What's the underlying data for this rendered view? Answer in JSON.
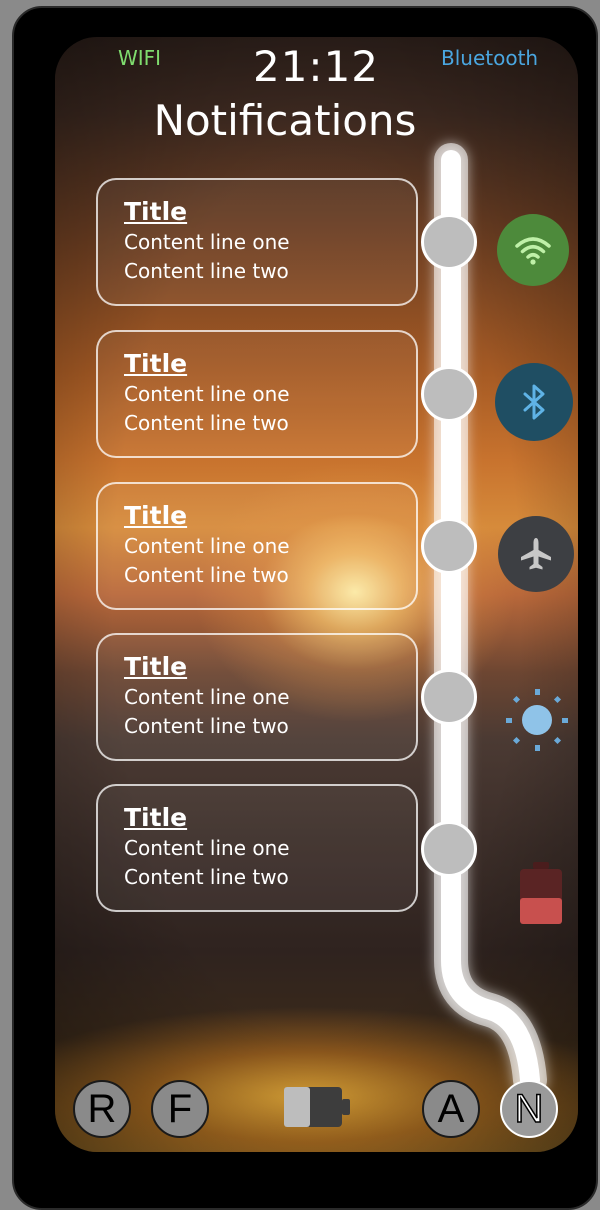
{
  "status_bar": {
    "wifi_label": "WIFI",
    "time": "21:12",
    "bluetooth_label": "Bluetooth"
  },
  "page_title": "Notifications",
  "notifications": [
    {
      "title": "Title",
      "line1": "Content line one",
      "line2": "Content line two"
    },
    {
      "title": "Title",
      "line1": "Content line one",
      "line2": "Content line two"
    },
    {
      "title": "Title",
      "line1": "Content line one",
      "line2": "Content line two"
    },
    {
      "title": "Title",
      "line1": "Content line one",
      "line2": "Content line two"
    },
    {
      "title": "Title",
      "line1": "Content line one",
      "line2": "Content line two"
    }
  ],
  "quick_settings": [
    {
      "icon": "wifi-icon",
      "color": "#4d8a3b"
    },
    {
      "icon": "bluetooth-icon",
      "color": "#1f4e63"
    },
    {
      "icon": "airplane-icon",
      "color": "#3d3f43"
    },
    {
      "icon": "brightness-icon",
      "color": "#8fc3e8"
    },
    {
      "icon": "battery-low-icon",
      "color": "#c8504e"
    }
  ],
  "bottom_buttons": {
    "r": "R",
    "f": "F",
    "a": "A",
    "n": "N"
  },
  "colors": {
    "wifi_text": "#7fdc6e",
    "bluetooth_text": "#4aa6e0",
    "track": "#ffffff",
    "node": "#bdbdbd"
  }
}
